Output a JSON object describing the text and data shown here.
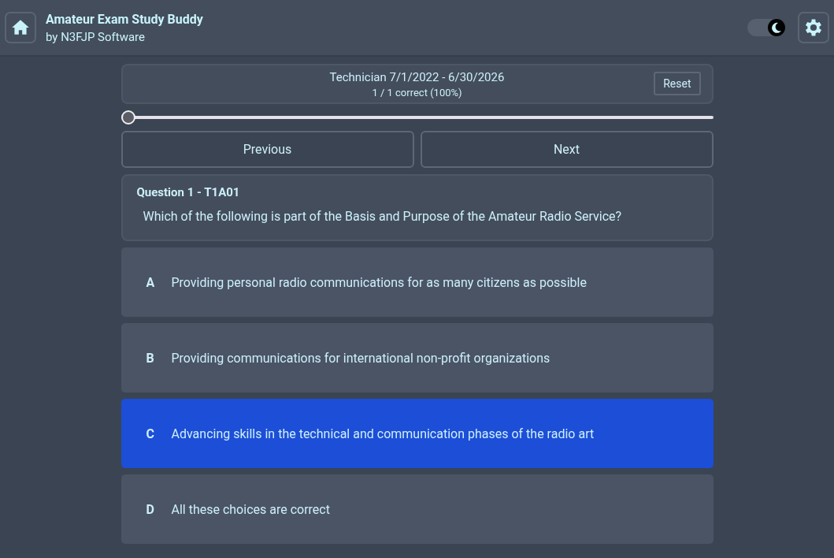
{
  "app": {
    "title": "Amateur Exam Study Buddy",
    "subtitle": "by N3FJP Software"
  },
  "dark_mode": {
    "on": true
  },
  "progress": {
    "pool": "Technician 7/1/2022 - 6/30/2026",
    "score": "1 / 1 correct (100%)",
    "reset_label": "Reset"
  },
  "slider": {
    "level": 0
  },
  "nav": {
    "previous": "Previous",
    "next": "Next"
  },
  "question": {
    "heading": "Question 1 - T1A01",
    "text": "Which of the following is part of the Basis and Purpose of the Amateur Radio Service?"
  },
  "answers": [
    {
      "letter": "A",
      "text": "Providing personal radio communications for as many citizens as possible",
      "selected": false
    },
    {
      "letter": "B",
      "text": "Providing communications for international non-profit organizations",
      "selected": false
    },
    {
      "letter": "C",
      "text": "Advancing skills in the technical and communication phases of the radio art",
      "selected": true
    },
    {
      "letter": "D",
      "text": "All these choices are correct",
      "selected": false
    }
  ]
}
